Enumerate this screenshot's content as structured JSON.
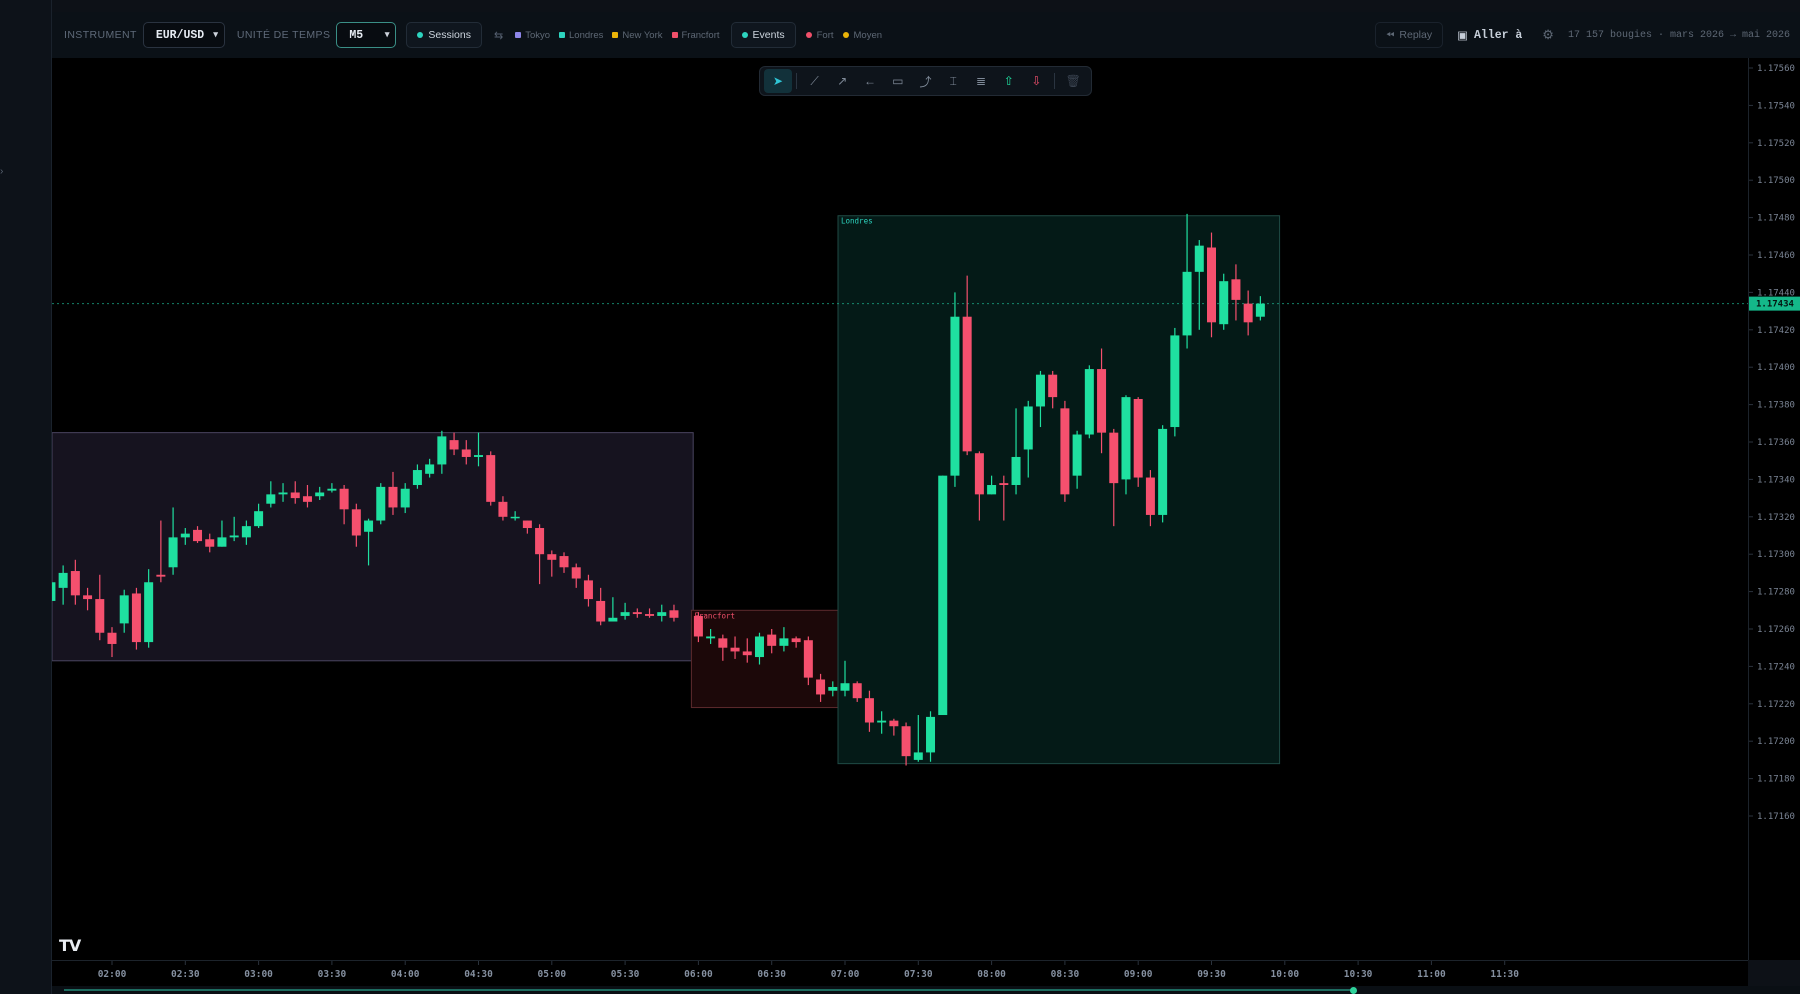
{
  "toolbar": {
    "instrument_label": "INSTRUMENT",
    "instrument_value": "EUR/USD",
    "timeframe_label": "UNITÉ DE TEMPS",
    "timeframe_value": "M5",
    "sessions_label": "Sessions",
    "sessions_legend": [
      {
        "label": "Tokyo",
        "color": "#8e86e8"
      },
      {
        "label": "Londres",
        "color": "#2dd4bf"
      },
      {
        "label": "New York",
        "color": "#eab308"
      },
      {
        "label": "Francfort",
        "color": "#f0506a"
      }
    ],
    "events_label": "Events",
    "events_legend": [
      {
        "label": "Fort",
        "color": "#f0506a"
      },
      {
        "label": "Moyen",
        "color": "#eab308"
      }
    ],
    "replay_label": "Replay",
    "goto_label": "Aller à",
    "range_info": "17 157 bougies · mars 2026 → mai 2026"
  },
  "drawing_tools": [
    "cursor-tool",
    "trendline-tool",
    "arrow-tool",
    "horizontal-ray-tool",
    "rectangle-tool",
    "path-tool",
    "measure-tool",
    "fib-tool",
    "long-position-tool",
    "short-position-tool",
    "delete-tool"
  ],
  "colors": {
    "up": "#1fe0a0",
    "down": "#f5506e",
    "tokyo_box": "#16131f",
    "londres_box": "#041a17",
    "francfort_box": "#1c0809"
  },
  "logo_text": "TV",
  "chart_data": {
    "type": "candlestick",
    "instrument": "EUR/USD",
    "timeframe": "M5",
    "ylim": [
      1.1715,
      1.1757
    ],
    "y_ticks": [
      "1.17560",
      "1.17540",
      "1.17520",
      "1.17500",
      "1.17480",
      "1.17460",
      "1.17440",
      "1.17420",
      "1.17400",
      "1.17380",
      "1.17360",
      "1.17340",
      "1.17320",
      "1.17300",
      "1.17280",
      "1.17260",
      "1.17240",
      "1.17220",
      "1.17200",
      "1.17180",
      "1.17160"
    ],
    "x_ticks": [
      "02:00",
      "02:30",
      "03:00",
      "03:30",
      "04:00",
      "04:30",
      "05:00",
      "05:30",
      "06:00",
      "06:30",
      "07:00",
      "07:30",
      "08:00",
      "08:30",
      "09:00",
      "09:30",
      "10:00",
      "10:30",
      "11:00",
      "11:30"
    ],
    "current_price": "1.17434",
    "sessions": [
      {
        "name": "Tokyo",
        "start": "01:35",
        "end": "05:55",
        "high": 1.17365,
        "low": 1.17243,
        "label": ""
      },
      {
        "name": "Francfort",
        "start": "06:00",
        "end": "06:55",
        "high": 1.1727,
        "low": 1.17218,
        "label": "Francfort"
      },
      {
        "name": "Londres",
        "start": "07:00",
        "end": "09:55",
        "high": 1.17481,
        "low": 1.17188,
        "label": "Londres"
      }
    ],
    "candles": [
      [
        "01:35",
        1.17275,
        1.17285,
        1.17268,
        1.17292
      ],
      [
        "01:40",
        1.17282,
        1.1729,
        1.17273,
        1.17294
      ],
      [
        "01:45",
        1.17291,
        1.17278,
        1.17273,
        1.17297
      ],
      [
        "01:50",
        1.17278,
        1.17276,
        1.1727,
        1.17282
      ],
      [
        "01:55",
        1.17276,
        1.17258,
        1.17254,
        1.17289
      ],
      [
        "02:00",
        1.17258,
        1.17252,
        1.17245,
        1.17261
      ],
      [
        "02:05",
        1.17263,
        1.17278,
        1.17258,
        1.17281
      ],
      [
        "02:10",
        1.17279,
        1.17253,
        1.17249,
        1.17282
      ],
      [
        "02:15",
        1.17253,
        1.17285,
        1.1725,
        1.17292
      ],
      [
        "02:20",
        1.17289,
        1.17288,
        1.17285,
        1.17318
      ],
      [
        "02:25",
        1.17293,
        1.17309,
        1.17289,
        1.17325
      ],
      [
        "02:30",
        1.17309,
        1.17311,
        1.17305,
        1.17314
      ],
      [
        "02:35",
        1.17313,
        1.17307,
        1.17306,
        1.17315
      ],
      [
        "02:40",
        1.17308,
        1.17304,
        1.17301,
        1.17311
      ],
      [
        "02:45",
        1.17304,
        1.17309,
        1.17304,
        1.17318
      ],
      [
        "02:50",
        1.17309,
        1.1731,
        1.17307,
        1.1732
      ],
      [
        "02:55",
        1.17309,
        1.17315,
        1.17305,
        1.17318
      ],
      [
        "03:00",
        1.17315,
        1.17323,
        1.17314,
        1.17327
      ],
      [
        "03:05",
        1.17327,
        1.17332,
        1.17325,
        1.17339
      ],
      [
        "03:10",
        1.17332,
        1.17333,
        1.17328,
        1.17338
      ],
      [
        "03:15",
        1.17333,
        1.1733,
        1.17327,
        1.17339
      ],
      [
        "03:20",
        1.17331,
        1.17328,
        1.17325,
        1.17337
      ],
      [
        "03:25",
        1.17331,
        1.17333,
        1.17329,
        1.17336
      ],
      [
        "03:30",
        1.17334,
        1.17335,
        1.17333,
        1.17338
      ],
      [
        "03:35",
        1.17335,
        1.17324,
        1.17316,
        1.17337
      ],
      [
        "03:40",
        1.17324,
        1.1731,
        1.17304,
        1.17327
      ],
      [
        "03:45",
        1.17312,
        1.17318,
        1.17294,
        1.17319
      ],
      [
        "03:50",
        1.17318,
        1.17336,
        1.17316,
        1.17338
      ],
      [
        "03:55",
        1.17336,
        1.17325,
        1.17321,
        1.17344
      ],
      [
        "04:00",
        1.17325,
        1.17335,
        1.17322,
        1.17338
      ],
      [
        "04:05",
        1.17337,
        1.17345,
        1.17335,
        1.17348
      ],
      [
        "04:10",
        1.17343,
        1.17348,
        1.17341,
        1.17351
      ],
      [
        "04:15",
        1.17348,
        1.17363,
        1.17343,
        1.17366
      ],
      [
        "04:20",
        1.17361,
        1.17356,
        1.17353,
        1.17365
      ],
      [
        "04:25",
        1.17356,
        1.17352,
        1.17348,
        1.17361
      ],
      [
        "04:30",
        1.17352,
        1.17353,
        1.17347,
        1.17365
      ],
      [
        "04:35",
        1.17353,
        1.17328,
        1.17326,
        1.17355
      ],
      [
        "04:40",
        1.17328,
        1.1732,
        1.17318,
        1.17331
      ],
      [
        "04:45",
        1.1732,
        1.1732,
        1.17318,
        1.17323
      ],
      [
        "04:50",
        1.17318,
        1.17314,
        1.17311,
        1.17318
      ],
      [
        "04:55",
        1.17314,
        1.173,
        1.17284,
        1.17316
      ],
      [
        "05:00",
        1.173,
        1.17297,
        1.17288,
        1.17302
      ],
      [
        "05:05",
        1.17299,
        1.17293,
        1.1729,
        1.17301
      ],
      [
        "05:10",
        1.17293,
        1.17287,
        1.17282,
        1.17295
      ],
      [
        "05:15",
        1.17286,
        1.17276,
        1.17272,
        1.17289
      ],
      [
        "05:20",
        1.17275,
        1.17264,
        1.17262,
        1.17282
      ],
      [
        "05:25",
        1.17264,
        1.17266,
        1.17264,
        1.17277
      ],
      [
        "05:30",
        1.17267,
        1.17269,
        1.17265,
        1.17274
      ],
      [
        "05:35",
        1.17269,
        1.17268,
        1.17266,
        1.17271
      ],
      [
        "05:40",
        1.17268,
        1.17267,
        1.17266,
        1.17271
      ],
      [
        "05:45",
        1.17267,
        1.17269,
        1.17264,
        1.17273
      ],
      [
        "05:50",
        1.1727,
        1.17266,
        1.17264,
        1.17273
      ],
      [
        "06:00",
        1.17267,
        1.17256,
        1.17253,
        1.17269
      ],
      [
        "06:05",
        1.17255,
        1.17256,
        1.17252,
        1.1726
      ],
      [
        "06:10",
        1.17255,
        1.1725,
        1.17243,
        1.17257
      ],
      [
        "06:15",
        1.1725,
        1.17248,
        1.17244,
        1.17256
      ],
      [
        "06:20",
        1.17248,
        1.17246,
        1.17242,
        1.17255
      ],
      [
        "06:25",
        1.17245,
        1.17256,
        1.17241,
        1.17258
      ],
      [
        "06:30",
        1.17257,
        1.17251,
        1.17247,
        1.1726
      ],
      [
        "06:35",
        1.17251,
        1.17255,
        1.17248,
        1.17261
      ],
      [
        "06:40",
        1.17255,
        1.17253,
        1.1725,
        1.17256
      ],
      [
        "06:45",
        1.17254,
        1.17234,
        1.1723,
        1.17256
      ],
      [
        "06:50",
        1.17233,
        1.17225,
        1.17221,
        1.17236
      ],
      [
        "06:55",
        1.17227,
        1.17229,
        1.17224,
        1.17232
      ],
      [
        "07:00",
        1.17227,
        1.17231,
        1.17224,
        1.17243
      ],
      [
        "07:05",
        1.17231,
        1.17223,
        1.17221,
        1.17232
      ],
      [
        "07:10",
        1.17223,
        1.1721,
        1.17205,
        1.17227
      ],
      [
        "07:15",
        1.1721,
        1.17211,
        1.17204,
        1.17216
      ],
      [
        "07:20",
        1.17211,
        1.17208,
        1.17203,
        1.17212
      ],
      [
        "07:25",
        1.17208,
        1.17192,
        1.17187,
        1.1721
      ],
      [
        "07:30",
        1.1719,
        1.17194,
        1.17189,
        1.17214
      ],
      [
        "07:35",
        1.17194,
        1.17213,
        1.17189,
        1.17216
      ],
      [
        "07:40",
        1.17214,
        1.17342,
        1.17214,
        1.17342
      ],
      [
        "07:45",
        1.17342,
        1.17427,
        1.17336,
        1.1744
      ],
      [
        "07:50",
        1.17427,
        1.17355,
        1.17353,
        1.17449
      ],
      [
        "07:55",
        1.17354,
        1.17332,
        1.17318,
        1.17355
      ],
      [
        "08:00",
        1.17332,
        1.17337,
        1.17332,
        1.17342
      ],
      [
        "08:05",
        1.17338,
        1.17337,
        1.17318,
        1.17342
      ],
      [
        "08:10",
        1.17337,
        1.17352,
        1.17332,
        1.17378
      ],
      [
        "08:15",
        1.17356,
        1.17379,
        1.17341,
        1.17382
      ],
      [
        "08:20",
        1.17379,
        1.17396,
        1.17368,
        1.17398
      ],
      [
        "08:25",
        1.17396,
        1.17384,
        1.17378,
        1.17398
      ],
      [
        "08:30",
        1.17378,
        1.17332,
        1.17328,
        1.17382
      ],
      [
        "08:35",
        1.17342,
        1.17364,
        1.17335,
        1.17366
      ],
      [
        "08:40",
        1.17364,
        1.17399,
        1.17362,
        1.17401
      ],
      [
        "08:45",
        1.17399,
        1.17365,
        1.17354,
        1.1741
      ],
      [
        "08:50",
        1.17365,
        1.17338,
        1.17315,
        1.17367
      ],
      [
        "08:55",
        1.1734,
        1.17384,
        1.17332,
        1.17385
      ],
      [
        "09:00",
        1.17383,
        1.17341,
        1.17336,
        1.17384
      ],
      [
        "09:05",
        1.17341,
        1.17321,
        1.17315,
        1.17345
      ],
      [
        "09:10",
        1.17321,
        1.17367,
        1.17317,
        1.17369
      ],
      [
        "09:15",
        1.17368,
        1.17417,
        1.17363,
        1.17421
      ],
      [
        "09:20",
        1.17417,
        1.17451,
        1.1741,
        1.17482
      ],
      [
        "09:25",
        1.17451,
        1.17465,
        1.1742,
        1.17468
      ],
      [
        "09:30",
        1.17464,
        1.17424,
        1.17416,
        1.17472
      ],
      [
        "09:35",
        1.17423,
        1.17446,
        1.1742,
        1.1745
      ],
      [
        "09:40",
        1.17447,
        1.17436,
        1.17425,
        1.17455
      ],
      [
        "09:45",
        1.17434,
        1.17424,
        1.17417,
        1.17441
      ],
      [
        "09:50",
        1.17427,
        1.17434,
        1.17425,
        1.17438
      ]
    ]
  }
}
